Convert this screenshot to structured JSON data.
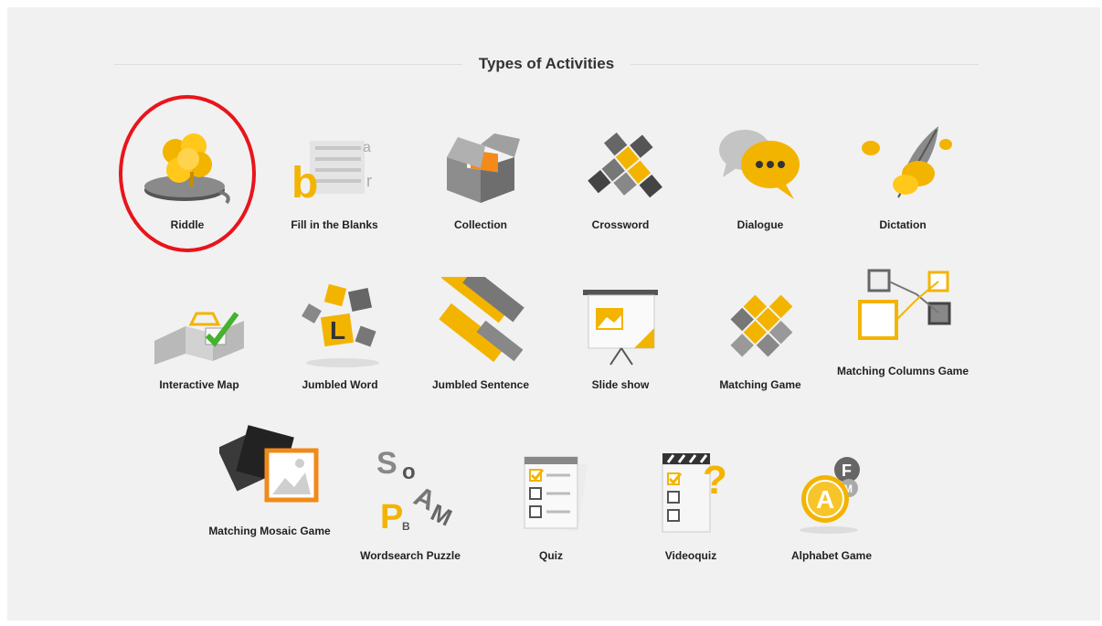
{
  "page": {
    "title": "Types of Activities"
  },
  "colors": {
    "background": "#f1f1f1",
    "accent": "#f5b800",
    "highlight": "#e8151b"
  },
  "activities": [
    {
      "label": "Riddle",
      "icon": "clover-icon"
    },
    {
      "label": "Fill in the Blanks",
      "icon": "letters-icon"
    },
    {
      "label": "Collection",
      "icon": "box-icon"
    },
    {
      "label": "Crossword",
      "icon": "crossword-icon"
    },
    {
      "label": "Dialogue",
      "icon": "speech-bubbles-icon"
    },
    {
      "label": "Dictation",
      "icon": "quill-icon"
    },
    {
      "label": "Interactive Map",
      "icon": "map-icon"
    },
    {
      "label": "Jumbled Word",
      "icon": "letter-blocks-icon"
    },
    {
      "label": "Jumbled Sentence",
      "icon": "word-strips-icon"
    },
    {
      "label": "Slide show",
      "icon": "projector-screen-icon"
    },
    {
      "label": "Matching Game",
      "icon": "matching-blocks-icon"
    },
    {
      "label": "Matching Columns Game",
      "icon": "connected-squares-icon"
    },
    {
      "label": "Matching Mosaic Game",
      "icon": "mosaic-tiles-icon"
    },
    {
      "label": "Wordsearch Puzzle",
      "icon": "scattered-letters-icon"
    },
    {
      "label": "Quiz",
      "icon": "checklist-icon"
    },
    {
      "label": "Videoquiz",
      "icon": "video-checklist-icon"
    },
    {
      "label": "Alphabet Game",
      "icon": "alphabet-circles-icon"
    }
  ]
}
